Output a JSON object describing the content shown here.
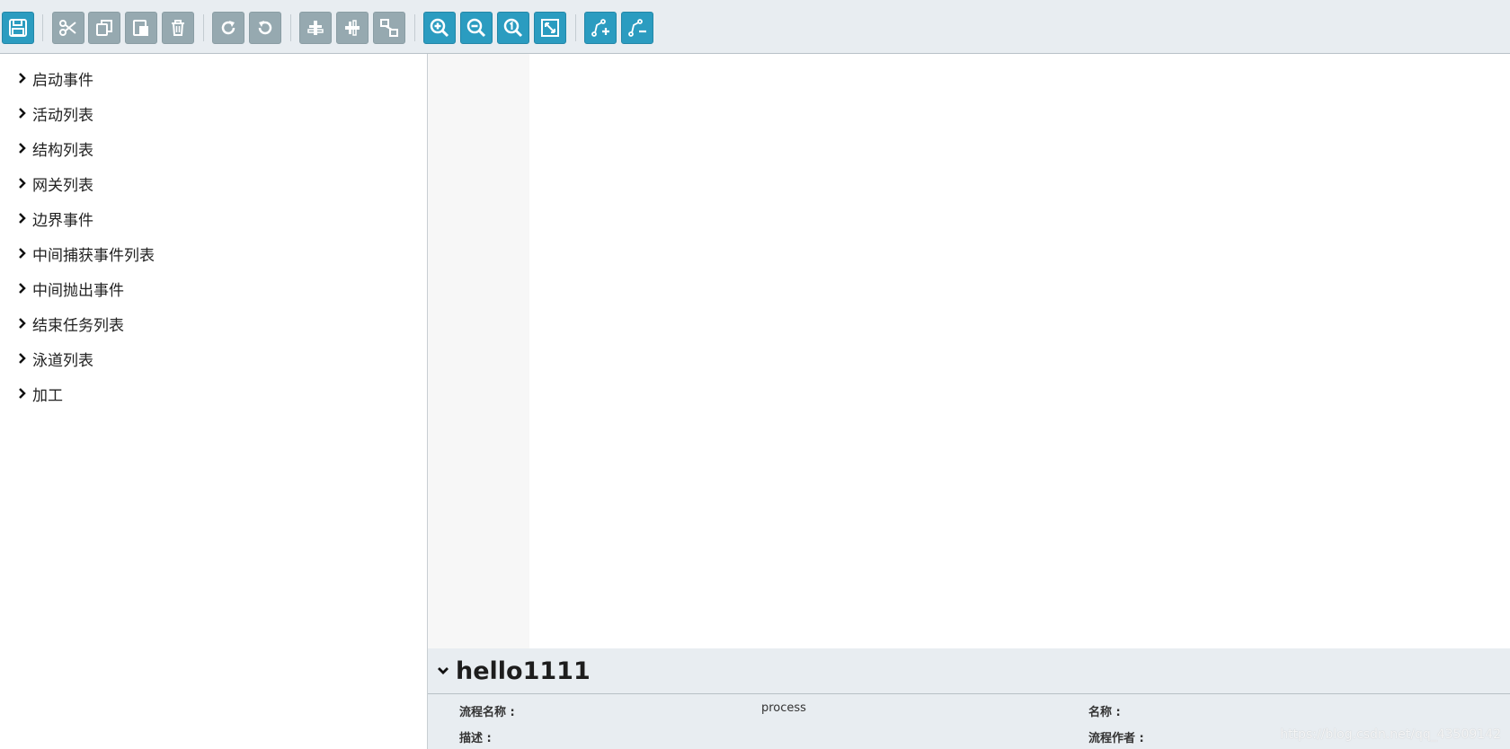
{
  "colors": {
    "toolbar_bg": "#e8edf1",
    "button_active": "#2b9cc0",
    "button_disabled": "#96a9b0",
    "panel_bg": "#e8edf1",
    "canvas_gutter": "#f7f7f7"
  },
  "toolbar": {
    "buttons": [
      {
        "icon": "save-icon",
        "state": "active"
      },
      {
        "icon": "cut-icon",
        "state": "disabled"
      },
      {
        "icon": "copy-icon",
        "state": "disabled"
      },
      {
        "icon": "paste-icon",
        "state": "disabled"
      },
      {
        "icon": "delete-icon",
        "state": "disabled"
      },
      {
        "icon": "redo-icon",
        "state": "disabled"
      },
      {
        "icon": "undo-icon",
        "state": "disabled"
      },
      {
        "icon": "align-horizontal-icon",
        "state": "disabled"
      },
      {
        "icon": "align-vertical-icon",
        "state": "disabled"
      },
      {
        "icon": "same-size-icon",
        "state": "disabled"
      },
      {
        "icon": "zoom-in-icon",
        "state": "active"
      },
      {
        "icon": "zoom-out-icon",
        "state": "active"
      },
      {
        "icon": "zoom-actual-icon",
        "state": "active"
      },
      {
        "icon": "zoom-fit-icon",
        "state": "active"
      },
      {
        "icon": "add-bendpoint-icon",
        "state": "active"
      },
      {
        "icon": "remove-bendpoint-icon",
        "state": "active"
      }
    ]
  },
  "sidebar": {
    "items": [
      {
        "label": "启动事件"
      },
      {
        "label": "活动列表"
      },
      {
        "label": "结构列表"
      },
      {
        "label": "网关列表"
      },
      {
        "label": "边界事件"
      },
      {
        "label": "中间捕获事件列表"
      },
      {
        "label": "中间抛出事件"
      },
      {
        "label": "结束任务列表"
      },
      {
        "label": "泳道列表"
      },
      {
        "label": "加工"
      }
    ]
  },
  "properties": {
    "title": "hello1111",
    "fields": {
      "process_name_label": "流程名称 :",
      "process_name_value": "process",
      "name_label": "名称 :",
      "description_label": "描述 :",
      "author_label": "流程作者 :"
    }
  },
  "watermark": "https://blog.csdn.net/qq_43509142"
}
